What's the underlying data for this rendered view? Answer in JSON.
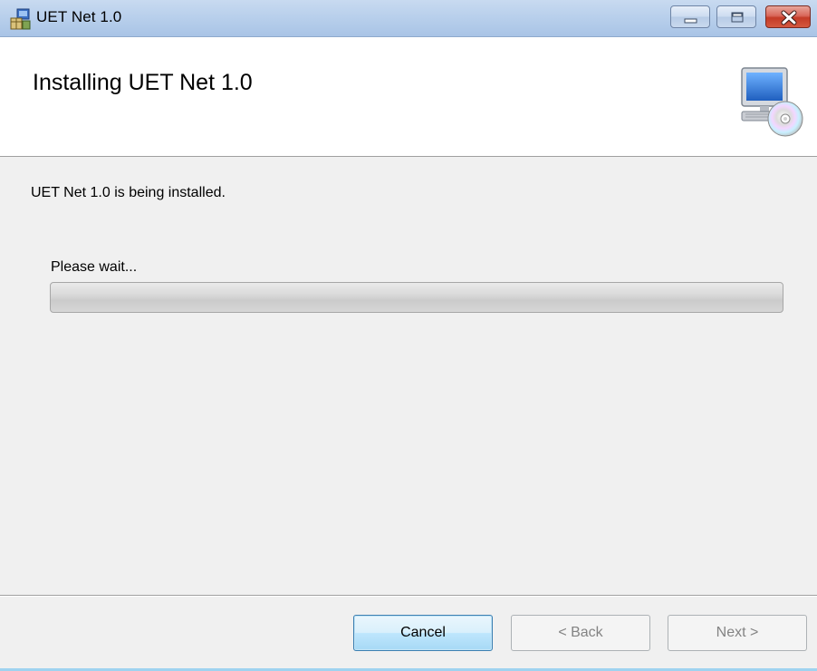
{
  "window": {
    "title": "UET Net 1.0",
    "controls": {
      "minimize": "minimize-icon",
      "maximize": "maximize-icon",
      "close": "close-icon"
    }
  },
  "banner": {
    "title": "Installing UET Net 1.0",
    "icon": "computer-disc-icon"
  },
  "body": {
    "status_text": "UET Net 1.0 is being installed.",
    "wait_text": "Please wait...",
    "progress": 0
  },
  "buttons": {
    "cancel": "Cancel",
    "back": "< Back",
    "next": "Next >"
  },
  "colors": {
    "accent": "#3c7fb1",
    "titlebar": "#b9d0ec",
    "close": "#c43b27"
  }
}
